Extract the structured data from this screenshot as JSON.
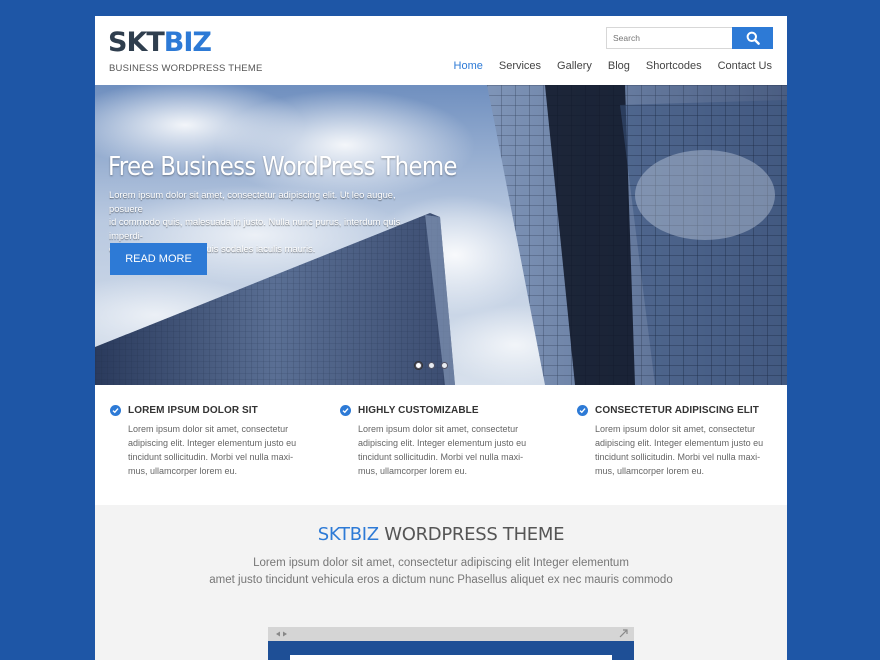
{
  "header": {
    "logo_part1": "SKT",
    "logo_part2": "BIZ",
    "tagline": "BUSINESS WORDPRESS THEME",
    "search_placeholder": "Search",
    "nav": [
      "Home",
      "Services",
      "Gallery",
      "Blog",
      "Shortcodes",
      "Contact Us"
    ],
    "active_nav": "Home"
  },
  "hero": {
    "title": "Free Business WordPress Theme",
    "text_lines": [
      "Lorem ipsum dolor sit amet, consectetur adipiscing elit. Ut leo augue, posuere",
      "id commodo quis, malesuada in justo. Nulla nunc purus, interdum quis imperdi-",
      "et in, placerat id felis. Duis sodales iaculis mauris."
    ],
    "button": "READ MORE",
    "slides": 3,
    "active_slide": 1
  },
  "features": [
    {
      "title": "LOREM IPSUM DOLOR SIT",
      "text_lines": [
        "Lorem ipsum dolor sit amet, consectetur",
        "adipiscing elit. Integer elementum justo eu",
        "tincidunt sollicitudin. Morbi vel nulla maxi-",
        "mus, ullamcorper lorem eu."
      ]
    },
    {
      "title": "HIGHLY CUSTOMIZABLE",
      "text_lines": [
        "Lorem ipsum dolor sit amet, consectetur",
        "adipiscing elit. Integer elementum justo eu",
        "tincidunt sollicitudin. Morbi vel nulla maxi-",
        "mus, ullamcorper lorem eu."
      ]
    },
    {
      "title": "CONSECTETUR ADIPISCING ELIT",
      "text_lines": [
        "Lorem ipsum dolor sit amet, consectetur",
        "adipiscing elit. Integer elementum justo eu",
        "tincidunt sollicitudin. Morbi vel nulla maxi-",
        "mus, ullamcorper lorem eu."
      ]
    }
  ],
  "section": {
    "title_highlight": "SKTBIZ",
    "title_rest": " WORDPRESS THEME",
    "text_lines": [
      "Lorem ipsum dolor sit amet, consectetur adipiscing elit Integer elementum",
      "amet justo tincidunt vehicula eros a dictum nunc Phasellus aliquet ex nec mauris commodo"
    ]
  },
  "colors": {
    "background": "#1e56a6",
    "accent": "#2d7ad6",
    "logo_dark": "#2f3e4e"
  }
}
